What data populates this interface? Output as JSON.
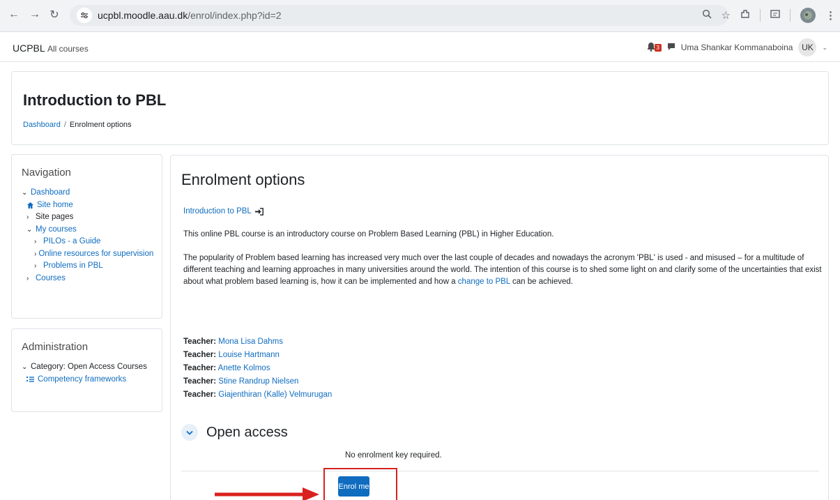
{
  "browser": {
    "url_host": "ucpbl.moodle.aau.dk",
    "url_path": "/enrol/index.php?id=2"
  },
  "topbar": {
    "brand": "UCPBL",
    "all_courses": "All courses",
    "notification_count": "3",
    "user_name": "Uma Shankar Kommanaboina",
    "user_initials": "UK"
  },
  "header": {
    "title": "Introduction to PBL",
    "breadcrumb": [
      "Dashboard",
      "Enrolment options"
    ]
  },
  "navigation": {
    "title": "Navigation",
    "items": [
      {
        "label": "Dashboard"
      },
      {
        "label": "Site home"
      },
      {
        "label": "Site pages"
      },
      {
        "label": "My courses"
      },
      {
        "label": "PILOs - a Guide"
      },
      {
        "label": "Online resources for supervision"
      },
      {
        "label": "Problems in PBL"
      },
      {
        "label": "Courses"
      }
    ]
  },
  "administration": {
    "title": "Administration",
    "category": "Category: Open Access Courses",
    "competency": "Competency frameworks"
  },
  "main": {
    "title": "Enrolment options",
    "course_link": "Introduction to PBL",
    "summary": "This online PBL course is an introductory course on Problem Based Learning (PBL) in Higher Education.",
    "description_before": "The popularity of Problem based learning has increased very much over the last couple of decades and nowadays the acronym 'PBL' is used - and misused – for a multitude of different teaching and learning approaches in many universities around the world. The intention of this course is to shed some light on and clarify some of the uncertainties that exist about what problem based learning is, how it can be implemented and how a ",
    "description_link": "change to PBL",
    "description_after": " can be achieved.",
    "teacher_label": "Teacher:",
    "teachers": [
      "Mona Lisa Dahms",
      "Louise Hartmann",
      "Anette Kolmos",
      "Stine Randrup Nielsen",
      "Giajenthiran (Kalle) Velmurugan"
    ],
    "section_title": "Open access",
    "no_key": "No enrolment key required.",
    "enrol_button": "Enrol me"
  },
  "colors": {
    "link": "#0f6cbf",
    "primary_button": "#0f6cbf",
    "annotation_red": "#d9211f"
  }
}
